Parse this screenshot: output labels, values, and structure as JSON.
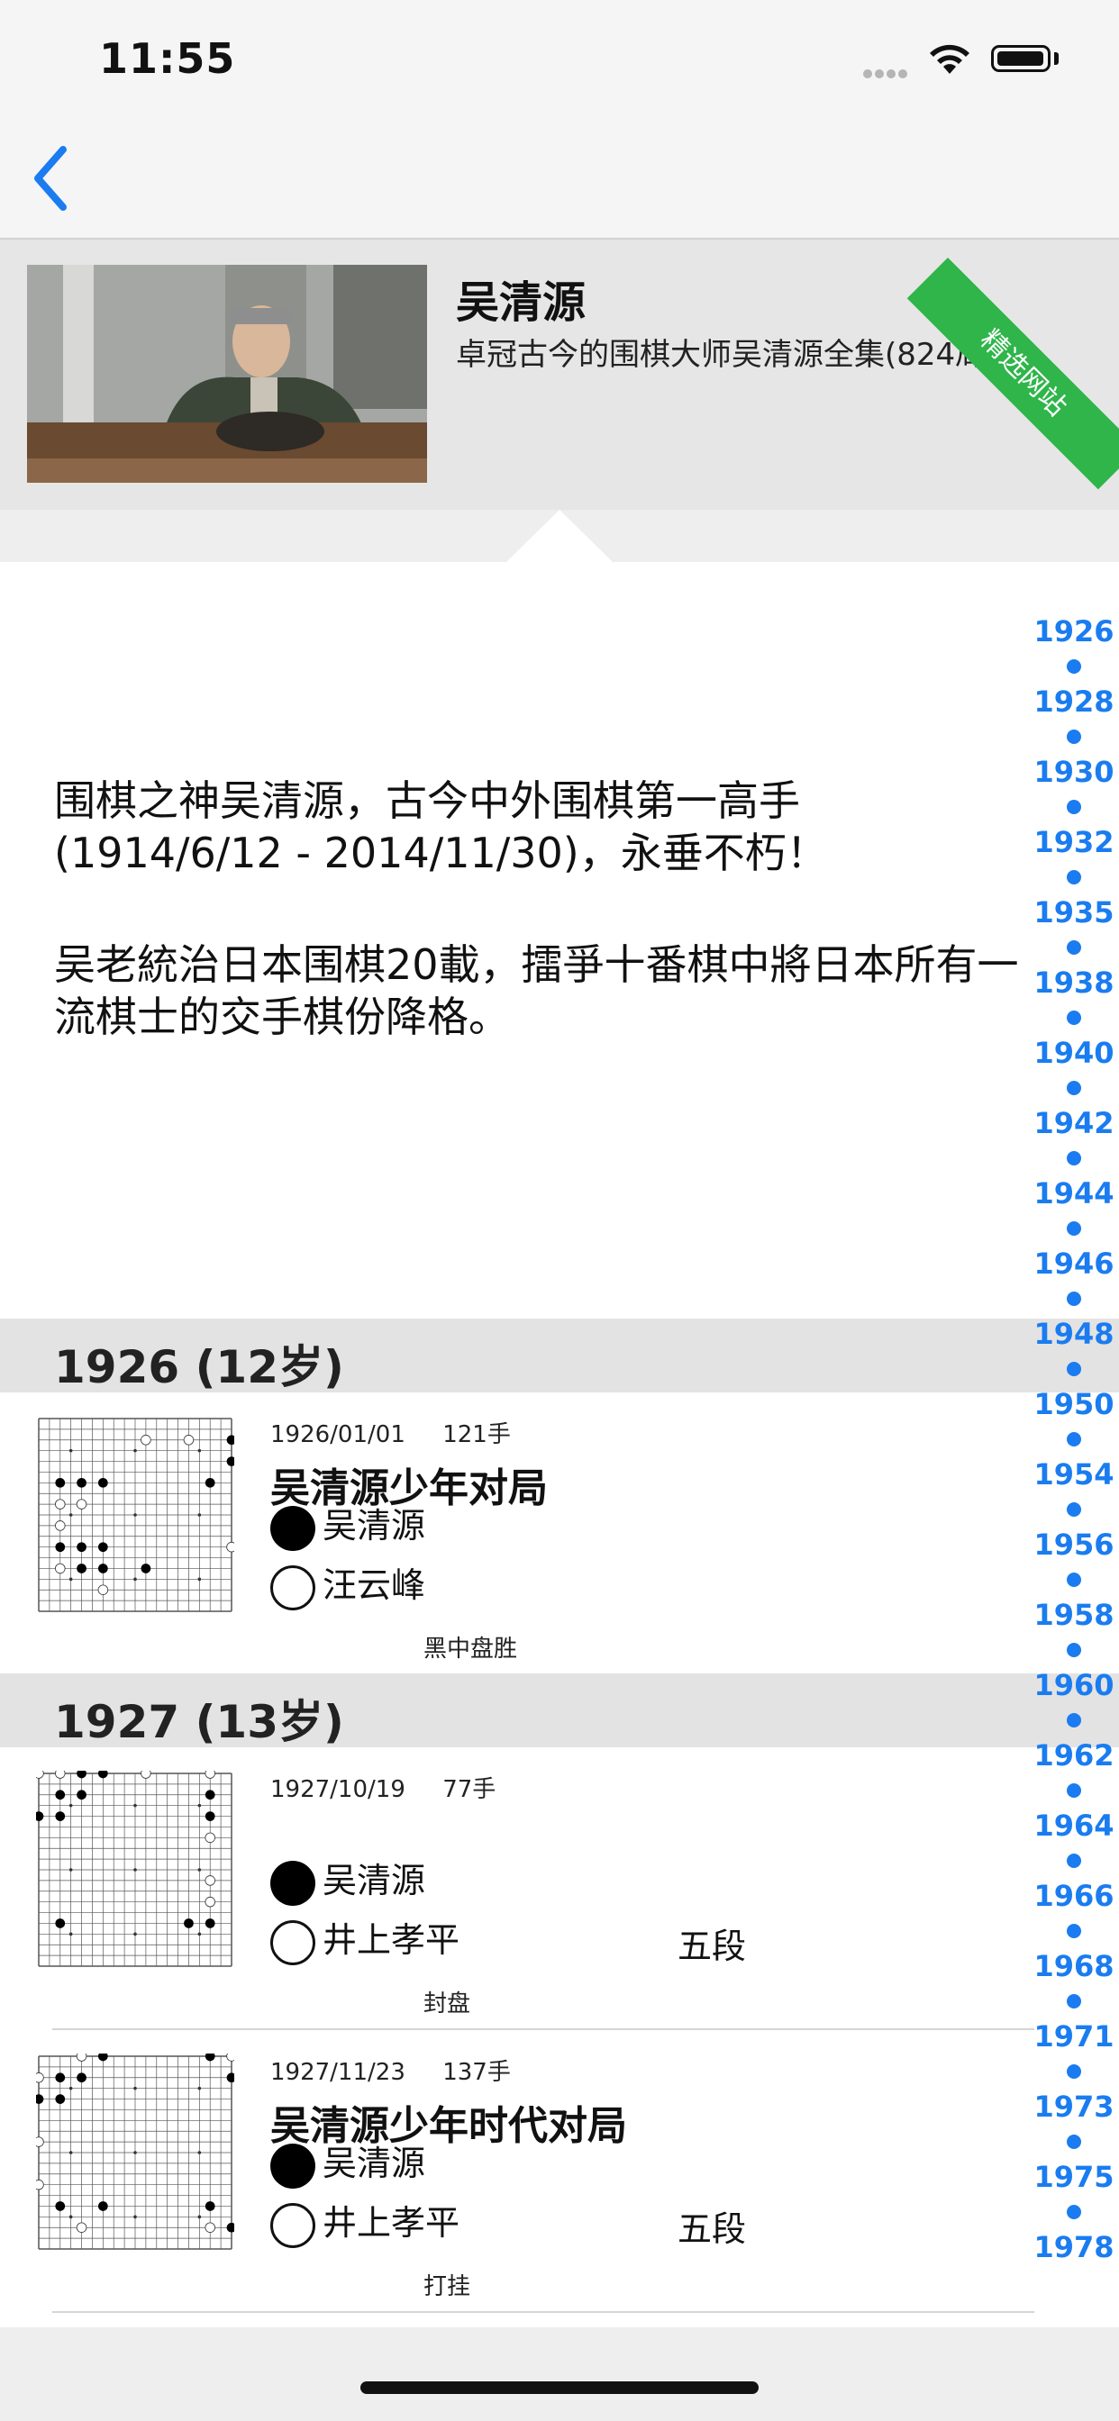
{
  "status_bar": {
    "time": "11:55"
  },
  "nav": {
    "back_icon": "chevron-left-icon"
  },
  "header": {
    "name": "吴清源",
    "subtitle": "卓冠古今的围棋大师吴清源全集(824局)",
    "ribbon": "精选网站"
  },
  "intro": {
    "paragraph1": "围棋之神吴清源，古今中外围棋第一高手(1914/6/12 - 2014/11/30)，永垂不朽！",
    "paragraph2": "吴老統治日本围棋20載，擂爭十番棋中將日本所有一流棋士的交手棋份降格。"
  },
  "sections": [
    {
      "label": "1926 (12岁)"
    },
    {
      "label": "1927 (13岁)"
    }
  ],
  "games": [
    {
      "date": "1926/01/01",
      "moves": "121手",
      "title": "吴清源少年对局",
      "black": "吴清源",
      "white": "汪云峰",
      "white_rank": "",
      "result": "黑中盘胜",
      "black_stones": [
        [
          1,
          3
        ],
        [
          2,
          3
        ],
        [
          3,
          3
        ],
        [
          8,
          3
        ],
        [
          1,
          6
        ],
        [
          2,
          6
        ],
        [
          3,
          6
        ],
        [
          2,
          7
        ],
        [
          3,
          7
        ],
        [
          5,
          7
        ],
        [
          9,
          1
        ],
        [
          9,
          2
        ]
      ],
      "white_stones": [
        [
          5,
          1
        ],
        [
          7,
          1
        ],
        [
          1,
          4
        ],
        [
          2,
          4
        ],
        [
          1,
          5
        ],
        [
          9,
          6
        ],
        [
          1,
          7
        ],
        [
          3,
          8
        ]
      ]
    },
    {
      "date": "1927/10/19",
      "moves": "77手",
      "title": "",
      "black": "吴清源",
      "white": "井上孝平",
      "white_rank": "五段",
      "result": "封盘",
      "black_stones": [
        [
          1,
          1
        ],
        [
          2,
          1
        ],
        [
          2,
          0
        ],
        [
          3,
          0
        ],
        [
          1,
          2
        ],
        [
          0,
          2
        ],
        [
          8,
          1
        ],
        [
          8,
          2
        ],
        [
          1,
          7
        ],
        [
          7,
          7
        ],
        [
          8,
          7
        ]
      ],
      "white_stones": [
        [
          1,
          0
        ],
        [
          0,
          0
        ],
        [
          5,
          0
        ],
        [
          8,
          0
        ],
        [
          8,
          3
        ],
        [
          8,
          5
        ],
        [
          8,
          6
        ]
      ]
    },
    {
      "date": "1927/11/23",
      "moves": "137手",
      "title": "吴清源少年时代对局",
      "black": "吴清源",
      "white": "井上孝平",
      "white_rank": "五段",
      "result": "打挂",
      "black_stones": [
        [
          1,
          1
        ],
        [
          2,
          1
        ],
        [
          3,
          0
        ],
        [
          0,
          2
        ],
        [
          1,
          2
        ],
        [
          8,
          0
        ],
        [
          9,
          1
        ],
        [
          1,
          7
        ],
        [
          3,
          7
        ],
        [
          8,
          7
        ],
        [
          9,
          8
        ]
      ],
      "white_stones": [
        [
          0,
          1
        ],
        [
          2,
          0
        ],
        [
          0,
          4
        ],
        [
          0,
          6
        ],
        [
          2,
          8
        ],
        [
          9,
          0
        ],
        [
          8,
          8
        ]
      ]
    }
  ],
  "year_index": [
    "1926",
    "1928",
    "1930",
    "1932",
    "1935",
    "1938",
    "1940",
    "1942",
    "1944",
    "1946",
    "1948",
    "1950",
    "1954",
    "1956",
    "1958",
    "1960",
    "1962",
    "1964",
    "1966",
    "1968",
    "1971",
    "1973",
    "1975",
    "1978"
  ],
  "colors": {
    "accent": "#1a7cf0",
    "ribbon": "#2fb54a",
    "section_bg": "#e3e3e3"
  }
}
